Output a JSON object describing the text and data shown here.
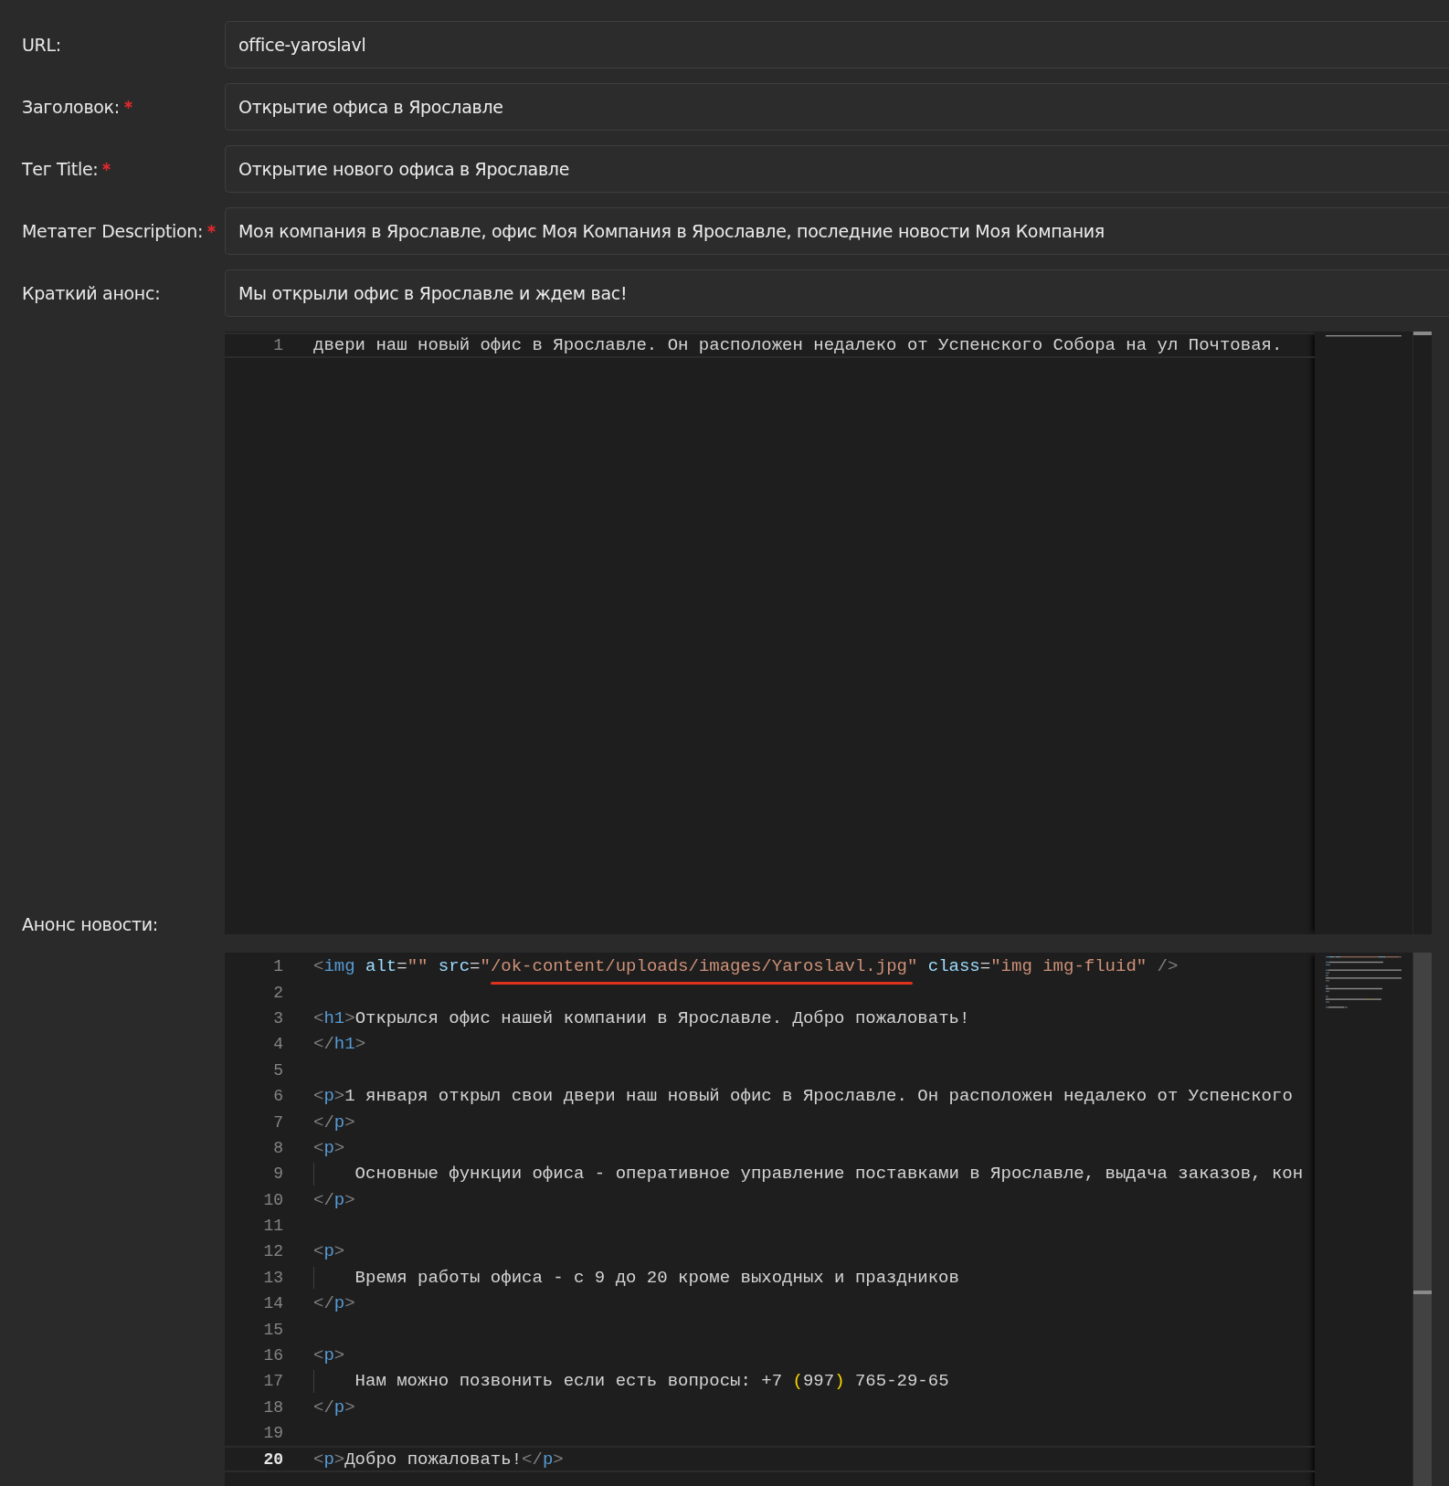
{
  "fields": [
    {
      "label": "URL:",
      "required": false,
      "value": "office-yaroslavl"
    },
    {
      "label": "Заголовок:",
      "required": true,
      "value": "Открытие офиса в Ярославле"
    },
    {
      "label": "Тег Title:",
      "required": true,
      "value": "Открытие нового офиса в Ярославле"
    },
    {
      "label": "Метатег Description:",
      "required": true,
      "value": "Моя компания в Ярославле, офис Моя Компания в Ярославле, последние новости Моя Компания"
    },
    {
      "label": "Краткий анонс:",
      "required": false,
      "value": "Мы открыли офис в Ярославле и ждем вас!"
    }
  ],
  "editors": [
    {
      "label": "Анонс новости:",
      "focused": false,
      "lines": [
        {
          "number": "1",
          "current": true,
          "guide": false,
          "tokens": [
            {
              "kind": "text",
              "text": "двери наш новый офис в Ярославле. Он расположен недалеко от Успенского Собора на ул Почтовая."
            }
          ]
        }
      ]
    },
    {
      "focused": true,
      "lines": [
        {
          "number": "1",
          "current": false,
          "guide": false,
          "tokens": [
            {
              "kind": "bracket",
              "text": "<"
            },
            {
              "kind": "tag",
              "text": "img"
            },
            {
              "kind": "attr",
              "text": " alt"
            },
            {
              "kind": "text",
              "text": "="
            },
            {
              "kind": "string",
              "text": "\"\""
            },
            {
              "kind": "attr",
              "text": " src"
            },
            {
              "kind": "text",
              "text": "="
            },
            {
              "kind": "string",
              "text": "\""
            },
            {
              "kind": "string",
              "text": "/ok-content/uploads/images/Yaroslavl.jpg",
              "underlined": true
            },
            {
              "kind": "string",
              "text": "\""
            },
            {
              "kind": "attr",
              "text": " class"
            },
            {
              "kind": "text",
              "text": "="
            },
            {
              "kind": "string",
              "text": "\"img img-fluid\""
            },
            {
              "kind": "bracket",
              "text": " />"
            }
          ]
        },
        {
          "number": "2",
          "current": false,
          "guide": false
        },
        {
          "number": "3",
          "current": false,
          "guide": false,
          "tokens": [
            {
              "kind": "bracket",
              "text": "<"
            },
            {
              "kind": "tag",
              "text": "h1"
            },
            {
              "kind": "bracket",
              "text": ">"
            },
            {
              "kind": "text",
              "text": "Открылся офис нашей компании в Ярославле. Добро пожаловать!"
            }
          ]
        },
        {
          "number": "4",
          "current": false,
          "guide": false,
          "tokens": [
            {
              "kind": "bracket",
              "text": "</"
            },
            {
              "kind": "tag",
              "text": "h1"
            },
            {
              "kind": "bracket",
              "text": ">"
            }
          ]
        },
        {
          "number": "5",
          "current": false,
          "guide": false
        },
        {
          "number": "6",
          "current": false,
          "guide": false,
          "tokens": [
            {
              "kind": "bracket",
              "text": "<"
            },
            {
              "kind": "tag",
              "text": "p"
            },
            {
              "kind": "bracket",
              "text": ">"
            },
            {
              "kind": "text",
              "text": "1 января открыл свои двери наш новый офис в Ярославле. Он расположен недалеко от Успенского"
            }
          ]
        },
        {
          "number": "7",
          "current": false,
          "guide": false,
          "tokens": [
            {
              "kind": "bracket",
              "text": "</"
            },
            {
              "kind": "tag",
              "text": "p"
            },
            {
              "kind": "bracket",
              "text": ">"
            }
          ]
        },
        {
          "number": "8",
          "current": false,
          "guide": false,
          "tokens": [
            {
              "kind": "bracket",
              "text": "<"
            },
            {
              "kind": "tag",
              "text": "p"
            },
            {
              "kind": "bracket",
              "text": ">"
            }
          ]
        },
        {
          "number": "9",
          "current": false,
          "guide": true,
          "tokens": [
            {
              "kind": "text",
              "text": "    Основные функции офиса - оперативное управление поставками в Ярославле, выдача заказов, кон"
            }
          ]
        },
        {
          "number": "10",
          "current": false,
          "guide": false,
          "tokens": [
            {
              "kind": "bracket",
              "text": "</"
            },
            {
              "kind": "tag",
              "text": "p"
            },
            {
              "kind": "bracket",
              "text": ">"
            }
          ]
        },
        {
          "number": "11",
          "current": false,
          "guide": false
        },
        {
          "number": "12",
          "current": false,
          "guide": false,
          "tokens": [
            {
              "kind": "bracket",
              "text": "<"
            },
            {
              "kind": "tag",
              "text": "p"
            },
            {
              "kind": "bracket",
              "text": ">"
            }
          ]
        },
        {
          "number": "13",
          "current": false,
          "guide": true,
          "tokens": [
            {
              "kind": "text",
              "text": "    Время работы офиса - с 9 до 20 кроме выходных и праздников"
            }
          ]
        },
        {
          "number": "14",
          "current": false,
          "guide": false,
          "tokens": [
            {
              "kind": "bracket",
              "text": "</"
            },
            {
              "kind": "tag",
              "text": "p"
            },
            {
              "kind": "bracket",
              "text": ">"
            }
          ]
        },
        {
          "number": "15",
          "current": false,
          "guide": false
        },
        {
          "number": "16",
          "current": false,
          "guide": false,
          "tokens": [
            {
              "kind": "bracket",
              "text": "<"
            },
            {
              "kind": "tag",
              "text": "p"
            },
            {
              "kind": "bracket",
              "text": ">"
            }
          ]
        },
        {
          "number": "17",
          "current": false,
          "guide": true,
          "tokens": [
            {
              "kind": "text",
              "text": "    Нам можно позвонить если есть вопросы: +7 "
            },
            {
              "kind": "paren",
              "text": "("
            },
            {
              "kind": "text",
              "text": "997"
            },
            {
              "kind": "paren",
              "text": ")"
            },
            {
              "kind": "text",
              "text": " 765-29-65"
            }
          ]
        },
        {
          "number": "18",
          "current": false,
          "guide": false,
          "tokens": [
            {
              "kind": "bracket",
              "text": "</"
            },
            {
              "kind": "tag",
              "text": "p"
            },
            {
              "kind": "bracket",
              "text": ">"
            }
          ]
        },
        {
          "number": "19",
          "current": false,
          "guide": false
        },
        {
          "number": "20",
          "current": true,
          "guide": false,
          "tokens": [
            {
              "kind": "bracket",
              "text": "<"
            },
            {
              "kind": "tag",
              "text": "p"
            },
            {
              "kind": "bracket",
              "text": ">"
            },
            {
              "kind": "text",
              "text": "Добро пожаловать!"
            },
            {
              "kind": "bracket",
              "text": "</"
            },
            {
              "kind": "tag",
              "text": "p"
            },
            {
              "kind": "bracket",
              "text": ">"
            }
          ]
        }
      ]
    }
  ]
}
